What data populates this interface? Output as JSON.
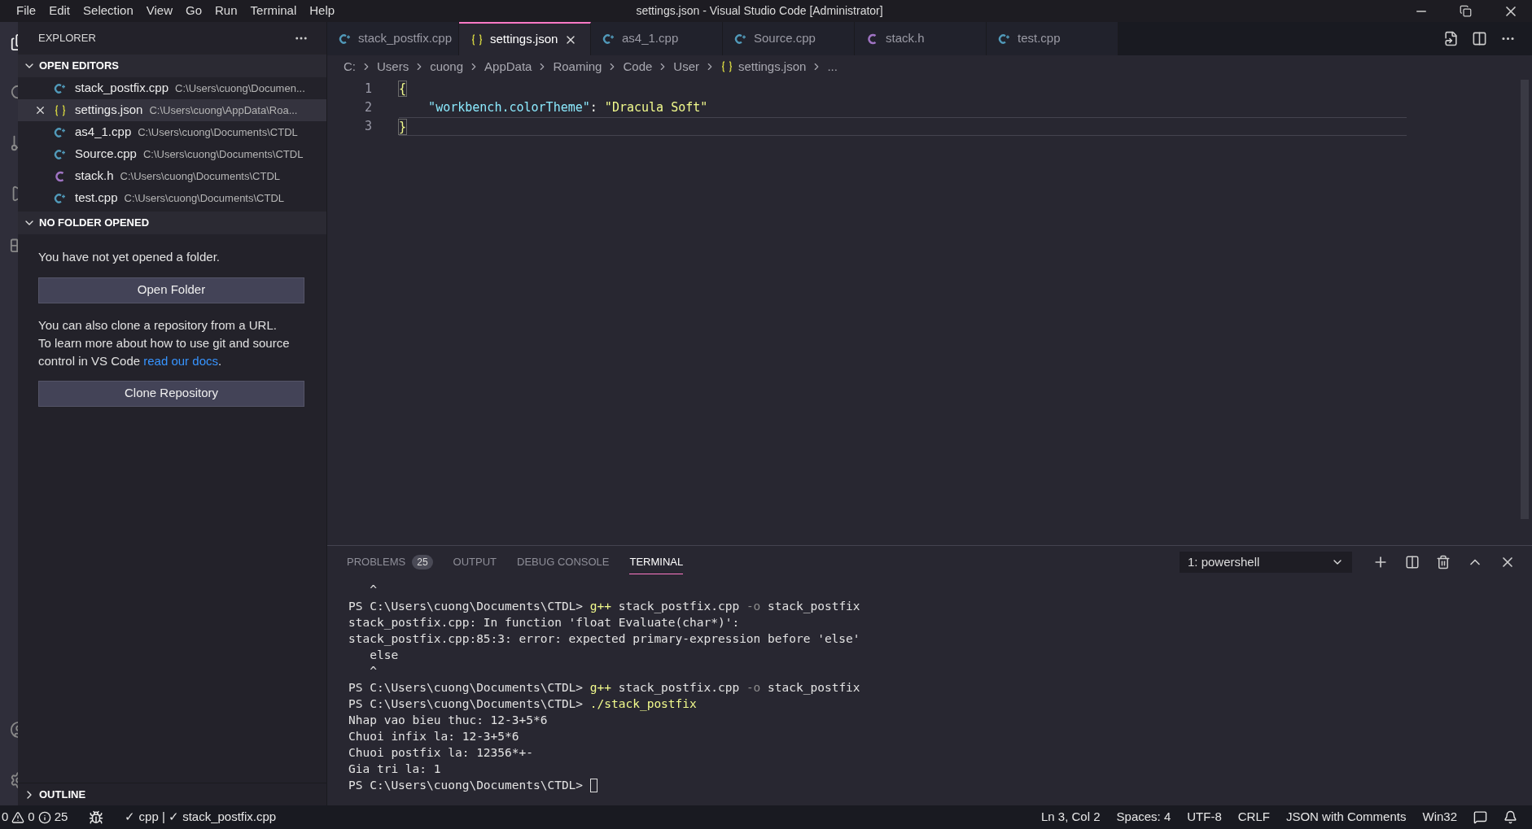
{
  "menu": [
    "File",
    "Edit",
    "Selection",
    "View",
    "Go",
    "Run",
    "Terminal",
    "Help"
  ],
  "window": {
    "title": "settings.json - Visual Studio Code [Administrator]"
  },
  "sidebar": {
    "title": "EXPLORER",
    "open_editors": {
      "title": "OPEN EDITORS",
      "expanded": true,
      "items": [
        {
          "name": "stack_postfix.cpp",
          "path": "C:\\Users\\cuong\\Documen...",
          "kind": "cpp",
          "selected": false
        },
        {
          "name": "settings.json",
          "path": "C:\\Users\\cuong\\AppData\\Roa...",
          "kind": "json",
          "selected": true
        },
        {
          "name": "as4_1.cpp",
          "path": "C:\\Users\\cuong\\Documents\\CTDL",
          "kind": "cpp",
          "selected": false
        },
        {
          "name": "Source.cpp",
          "path": "C:\\Users\\cuong\\Documents\\CTDL",
          "kind": "cpp",
          "selected": false
        },
        {
          "name": "stack.h",
          "path": "C:\\Users\\cuong\\Documents\\CTDL",
          "kind": "c",
          "selected": false
        },
        {
          "name": "test.cpp",
          "path": "C:\\Users\\cuong\\Documents\\CTDL",
          "kind": "cpp",
          "selected": false
        }
      ]
    },
    "no_folder": {
      "title": "NO FOLDER OPENED",
      "expanded": true,
      "message": "You have not yet opened a folder.",
      "open_button": "Open Folder",
      "clone_text": "You can also clone a repository from a URL. To learn more about how to use git and source control in VS Code",
      "clone_link": "read our docs",
      "clone_end": ".",
      "clone_button": "Clone Repository"
    },
    "outline": {
      "title": "OUTLINE",
      "expanded": false
    }
  },
  "tabs": [
    {
      "label": "stack_postfix.cpp",
      "kind": "cpp",
      "selected": false
    },
    {
      "label": "settings.json",
      "kind": "json",
      "selected": true
    },
    {
      "label": "as4_1.cpp",
      "kind": "cpp",
      "selected": false
    },
    {
      "label": "Source.cpp",
      "kind": "cpp",
      "selected": false
    },
    {
      "label": "stack.h",
      "kind": "c",
      "selected": false
    },
    {
      "label": "test.cpp",
      "kind": "cpp",
      "selected": false
    }
  ],
  "breadcrumb": [
    {
      "label": "C:",
      "kind": "text"
    },
    {
      "label": "Users",
      "kind": "text"
    },
    {
      "label": "cuong",
      "kind": "text"
    },
    {
      "label": "AppData",
      "kind": "text"
    },
    {
      "label": "Roaming",
      "kind": "text"
    },
    {
      "label": "Code",
      "kind": "text"
    },
    {
      "label": "User",
      "kind": "text"
    },
    {
      "label": "settings.json",
      "kind": "json"
    },
    {
      "label": "...",
      "kind": "text"
    }
  ],
  "editor": {
    "lines": [
      {
        "number": "1",
        "tokens": [
          {
            "text": "{",
            "kind": "brace"
          }
        ]
      },
      {
        "number": "2",
        "tokens": [
          {
            "text": "\"workbench.colorTheme\"",
            "kind": "key"
          },
          {
            "text": ": ",
            "kind": "punct"
          },
          {
            "text": "\"Dracula Soft\"",
            "kind": "string"
          }
        ]
      },
      {
        "number": "3",
        "tokens": [
          {
            "text": "}",
            "kind": "brace"
          }
        ]
      }
    ]
  },
  "panel": {
    "tabs": [
      {
        "label": "PROBLEMS",
        "badge": "25",
        "selected": false
      },
      {
        "label": "OUTPUT",
        "selected": false
      },
      {
        "label": "DEBUG CONSOLE",
        "selected": false
      },
      {
        "label": "TERMINAL",
        "selected": true
      }
    ],
    "terminal_select": "1: powershell",
    "terminal": [
      [
        {
          "text": "   ^",
          "kind": "out"
        }
      ],
      [
        {
          "text": "PS C:\\Users\\cuong\\Documents\\CTDL> ",
          "kind": "out"
        },
        {
          "text": "g++",
          "kind": "cmd"
        },
        {
          "text": " stack_postfix.cpp ",
          "kind": "out"
        },
        {
          "text": "-o",
          "kind": "flag"
        },
        {
          "text": " stack_postfix",
          "kind": "out"
        }
      ],
      [
        {
          "text": "stack_postfix.cpp: In function 'float Evaluate(char*)':",
          "kind": "out"
        }
      ],
      [
        {
          "text": "stack_postfix.cpp:85:3: error: expected primary-expression before 'else'",
          "kind": "out"
        }
      ],
      [
        {
          "text": "   else",
          "kind": "out"
        }
      ],
      [
        {
          "text": "   ^",
          "kind": "out"
        }
      ],
      [
        {
          "text": "PS C:\\Users\\cuong\\Documents\\CTDL> ",
          "kind": "out"
        },
        {
          "text": "g++",
          "kind": "cmd"
        },
        {
          "text": " stack_postfix.cpp ",
          "kind": "out"
        },
        {
          "text": "-o",
          "kind": "flag"
        },
        {
          "text": " stack_postfix",
          "kind": "out"
        }
      ],
      [
        {
          "text": "PS C:\\Users\\cuong\\Documents\\CTDL> ",
          "kind": "out"
        },
        {
          "text": "./stack_postfix",
          "kind": "cmd"
        }
      ],
      [
        {
          "text": "Nhap vao bieu thuc: 12-3+5*6",
          "kind": "out"
        }
      ],
      [
        {
          "text": "Chuoi infix la: 12-3+5*6",
          "kind": "out"
        }
      ],
      [
        {
          "text": "Chuoi postfix la: 12356*+-",
          "kind": "out"
        }
      ],
      [
        {
          "text": "Gia tri la: 1",
          "kind": "out"
        }
      ],
      [
        {
          "text": "PS C:\\Users\\cuong\\Documents\\CTDL> ",
          "kind": "out"
        },
        {
          "kind": "cursor"
        }
      ]
    ]
  },
  "status_bar": {
    "errors": "0",
    "warnings": "0",
    "infos": "25",
    "build": "✓ cpp | ✓ stack_postfix.cpp",
    "right": [
      "Ln 3, Col 2",
      "Spaces: 4",
      "UTF-8",
      "CRLF",
      "JSON with Comments",
      "Win32"
    ]
  }
}
